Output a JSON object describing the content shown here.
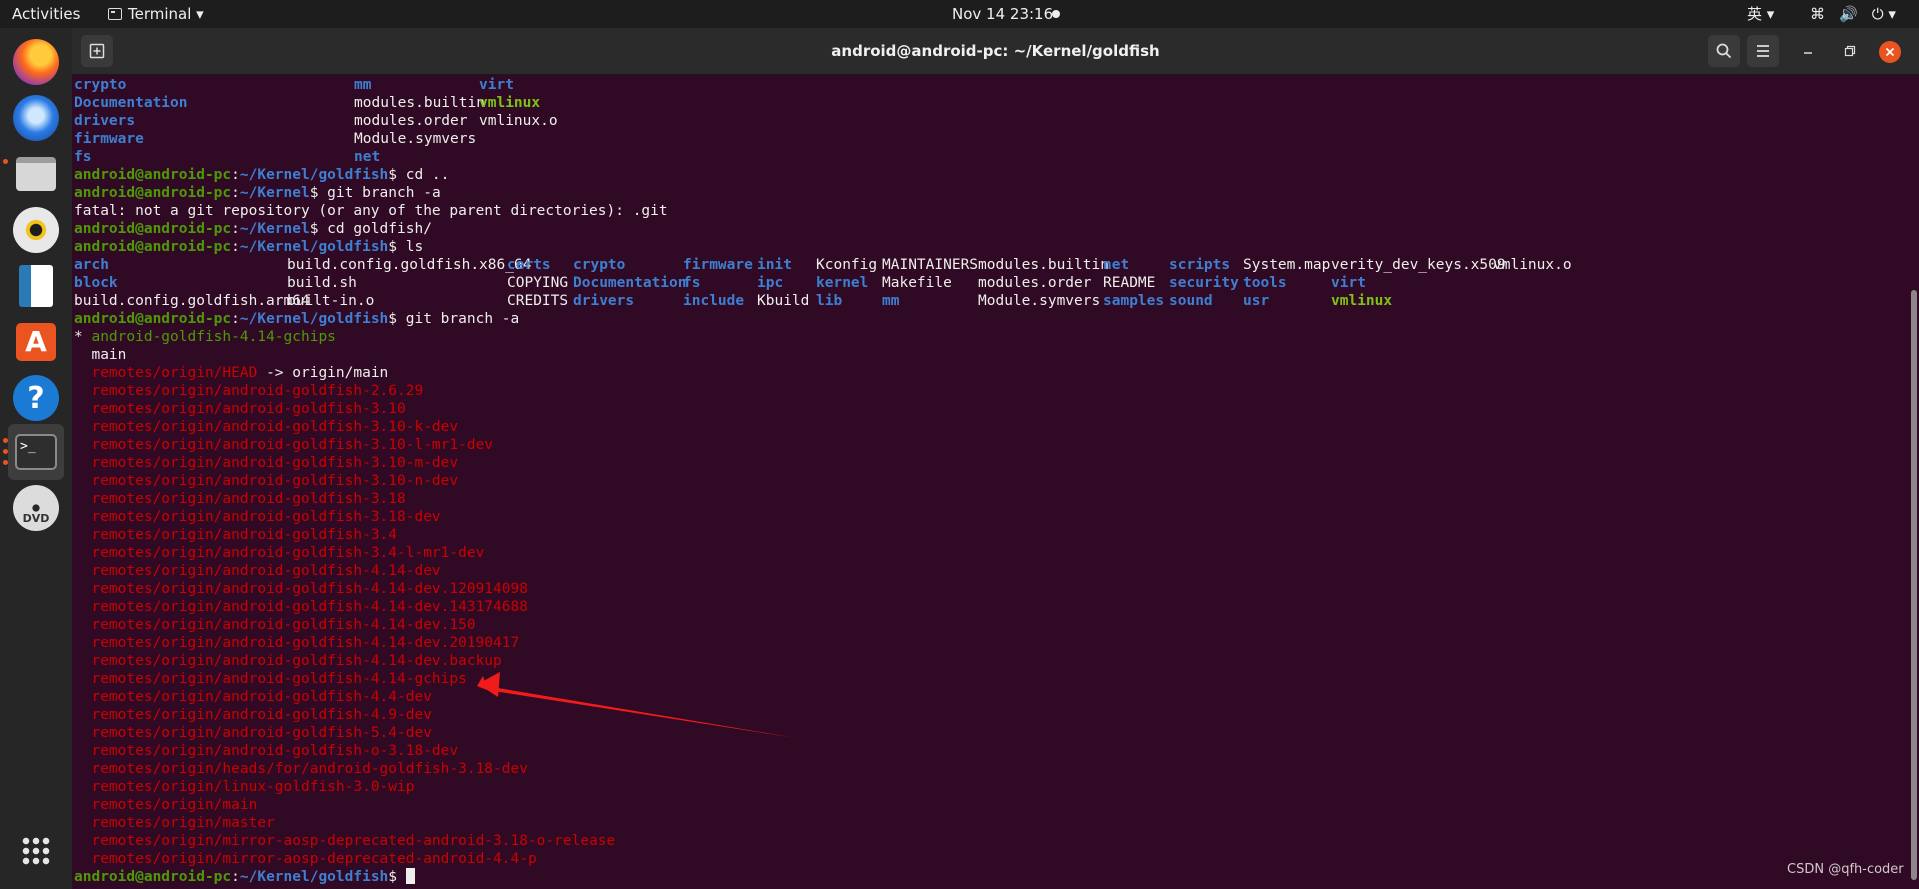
{
  "topbar": {
    "activities": "Activities",
    "app_menu": "Terminal ▾",
    "clock": "Nov 14  23:16",
    "lang": "英 ▾",
    "tray_network": "⌘",
    "tray_volume": "🔊",
    "tray_power": "⏻ ▾"
  },
  "window": {
    "title": "android@android-pc: ~/Kernel/goldfish"
  },
  "terminal": {
    "prompt_user": "android@android-pc",
    "prompt_sep": ":",
    "prompt_kernel": "~/Kernel",
    "prompt_goldfish": "~/Kernel/goldfish",
    "prompt_dollar": "$",
    "ls_top": [
      [
        "crypto",
        "mm",
        "virt"
      ],
      [
        "Documentation",
        "modules.builtin",
        "vmlinux"
      ],
      [
        "drivers",
        "modules.order",
        "vmlinux.o"
      ],
      [
        "firmware",
        "Module.symvers",
        ""
      ],
      [
        "fs",
        "net",
        ""
      ]
    ],
    "cmd_cd_up": " cd ..",
    "cmd_git_branch": " git branch -a",
    "git_error": "fatal: not a git repository (or any of the parent directories): .git",
    "cmd_cd_goldfish": " cd goldfish/",
    "cmd_ls": " ls",
    "ls_row1": [
      "arch",
      "build.config.goldfish.x86_64",
      "certs",
      "crypto",
      "firmware",
      "init",
      "Kconfig",
      "MAINTAINERS",
      "modules.builtin",
      "net",
      "scripts",
      "System.map",
      "verity_dev_keys.x509",
      "vmlinux.o"
    ],
    "ls_row2": [
      "block",
      "build.sh",
      "COPYING",
      "Documentation",
      "fs",
      "ipc",
      "kernel",
      "Makefile",
      "modules.order",
      "README",
      "security",
      "tools",
      "virt"
    ],
    "ls_row3": [
      "build.config.goldfish.arm64",
      "built-in.o",
      "CREDITS",
      "drivers",
      "include",
      "Kbuild",
      "lib",
      "mm",
      "Module.symvers",
      "samples",
      "sound",
      "usr",
      "vmlinux"
    ],
    "current_branch_marker": "* ",
    "current_branch": "android-goldfish-4.14-gchips",
    "local_main": "  main",
    "remote_head": "remotes/origin/HEAD",
    "remote_head_target": " -> origin/main",
    "remotes": [
      "remotes/origin/android-goldfish-2.6.29",
      "remotes/origin/android-goldfish-3.10",
      "remotes/origin/android-goldfish-3.10-k-dev",
      "remotes/origin/android-goldfish-3.10-l-mr1-dev",
      "remotes/origin/android-goldfish-3.10-m-dev",
      "remotes/origin/android-goldfish-3.10-n-dev",
      "remotes/origin/android-goldfish-3.18",
      "remotes/origin/android-goldfish-3.18-dev",
      "remotes/origin/android-goldfish-3.4",
      "remotes/origin/android-goldfish-3.4-l-mr1-dev",
      "remotes/origin/android-goldfish-4.14-dev",
      "remotes/origin/android-goldfish-4.14-dev.120914098",
      "remotes/origin/android-goldfish-4.14-dev.143174688",
      "remotes/origin/android-goldfish-4.14-dev.150",
      "remotes/origin/android-goldfish-4.14-dev.20190417",
      "remotes/origin/android-goldfish-4.14-dev.backup",
      "remotes/origin/android-goldfish-4.14-gchips",
      "remotes/origin/android-goldfish-4.4-dev",
      "remotes/origin/android-goldfish-4.9-dev",
      "remotes/origin/android-goldfish-5.4-dev",
      "remotes/origin/android-goldfish-o-3.18-dev",
      "remotes/origin/heads/for/android-goldfish-3.18-dev",
      "remotes/origin/linux-goldfish-3.0-wip",
      "remotes/origin/main",
      "remotes/origin/master",
      "remotes/origin/mirror-aosp-deprecated-android-3.18-o-release",
      "remotes/origin/mirror-aosp-deprecated-android-4.4-p"
    ]
  },
  "watermark": "CSDN @qfh-coder",
  "colors": {
    "terminal_bg": "#300a24",
    "dir_blue": "#3f7fd1",
    "prompt_green": "#4e9a06",
    "remote_red": "#cc0000",
    "close_orange": "#e95420"
  }
}
